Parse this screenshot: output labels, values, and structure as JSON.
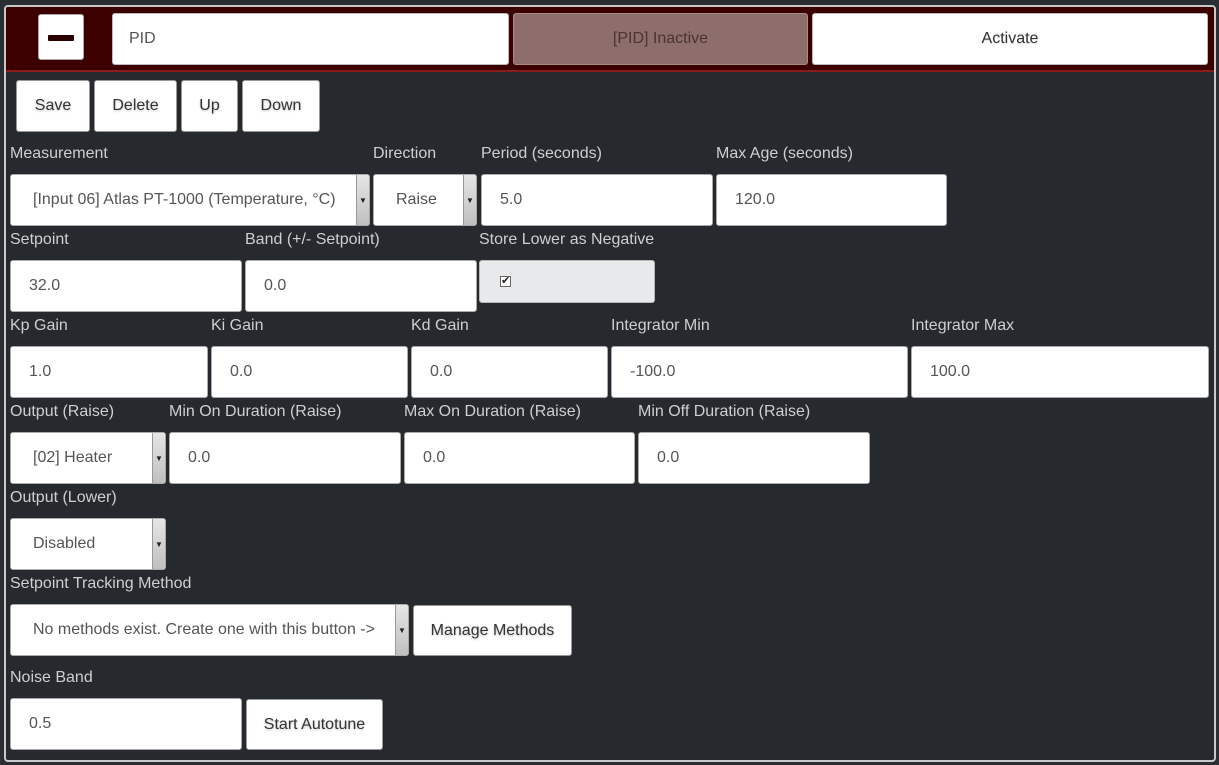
{
  "header": {
    "name_value": "PID",
    "status": "[PID] Inactive",
    "activate_label": "Activate"
  },
  "toolbar": {
    "save_label": "Save",
    "delete_label": "Delete",
    "up_label": "Up",
    "down_label": "Down"
  },
  "form": {
    "measurement": {
      "label": "Measurement",
      "value": "[Input 06] Atlas PT-1000 (Temperature, °C)"
    },
    "direction": {
      "label": "Direction",
      "value": "Raise"
    },
    "period": {
      "label": "Period (seconds)",
      "value": "5.0"
    },
    "max_age": {
      "label": "Max Age (seconds)",
      "value": "120.0"
    },
    "setpoint": {
      "label": "Setpoint",
      "value": "32.0"
    },
    "band": {
      "label": "Band (+/- Setpoint)",
      "value": "0.0"
    },
    "store_lower_negative": {
      "label": "Store Lower as Negative",
      "checked": true,
      "glyph": "✔"
    },
    "kp_gain": {
      "label": "Kp Gain",
      "value": "1.0"
    },
    "ki_gain": {
      "label": "Ki Gain",
      "value": "0.0"
    },
    "kd_gain": {
      "label": "Kd Gain",
      "value": "0.0"
    },
    "integrator_min": {
      "label": "Integrator Min",
      "value": "-100.0"
    },
    "integrator_max": {
      "label": "Integrator Max",
      "value": "100.0"
    },
    "output_raise": {
      "label": "Output (Raise)",
      "value": "[02] Heater"
    },
    "min_on_raise": {
      "label": "Min On Duration (Raise)",
      "value": "0.0"
    },
    "max_on_raise": {
      "label": "Max On Duration (Raise)",
      "value": "0.0"
    },
    "min_off_raise": {
      "label": "Min Off Duration (Raise)",
      "value": "0.0"
    },
    "output_lower": {
      "label": "Output (Lower)",
      "value": "Disabled"
    },
    "setpoint_tracking": {
      "label": "Setpoint Tracking Method",
      "value": "No methods exist. Create one with this button ->"
    },
    "manage_methods_label": "Manage Methods",
    "noise_band": {
      "label": "Noise Band",
      "value": "0.5"
    },
    "start_autotune_label": "Start Autotune"
  },
  "colors": {
    "header_bg": "#3c0000",
    "page_bg": "#26292d",
    "status_bg": "#8e6d6d"
  }
}
